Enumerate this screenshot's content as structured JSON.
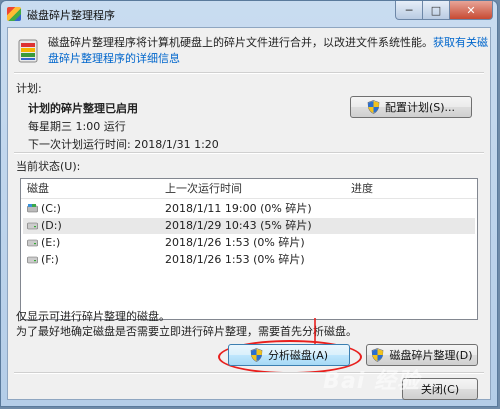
{
  "window": {
    "title": "磁盘碎片整理程序",
    "controls": {
      "minimize": "─",
      "maximize": "□",
      "close": "✕"
    }
  },
  "header": {
    "description": "磁盘碎片整理程序将计算机硬盘上的碎片文件进行合并，以改进文件系统性能。",
    "link_text": "获取有关磁盘碎片整理程序的详细信息"
  },
  "schedule": {
    "section_label": "计划:",
    "status": "计划的碎片整理已启用",
    "frequency": "每星期三  1:00 运行",
    "next_run": "下一次计划运行时间: 2018/1/31 1:20",
    "configure_button": "配置计划(S)..."
  },
  "current_status": {
    "section_label": "当前状态(U):",
    "columns": [
      "磁盘",
      "上一次运行时间",
      "进度"
    ],
    "rows": [
      {
        "disk": "(C:)",
        "last_run": "2018/1/11 19:00 (0% 碎片)",
        "progress": ""
      },
      {
        "disk": "(D:)",
        "last_run": "2018/1/29 10:43 (5% 碎片)",
        "progress": ""
      },
      {
        "disk": "(E:)",
        "last_run": "2018/1/26 1:53 (0% 碎片)",
        "progress": ""
      },
      {
        "disk": "(F:)",
        "last_run": "2018/1/26 1:53 (0% 碎片)",
        "progress": ""
      }
    ]
  },
  "notes": {
    "line1": "仅显示可进行碎片整理的磁盘。",
    "line2": "为了最好地确定磁盘是否需要立即进行碎片整理，需要首先分析磁盘。"
  },
  "actions": {
    "analyze_button": "分析磁盘(A)",
    "defrag_button": "磁盘碎片整理(D)",
    "close_button": "关闭(C)"
  },
  "watermark": "Bai 经验",
  "colors": {
    "annotation": "#e8201e",
    "link": "#0066cc"
  }
}
